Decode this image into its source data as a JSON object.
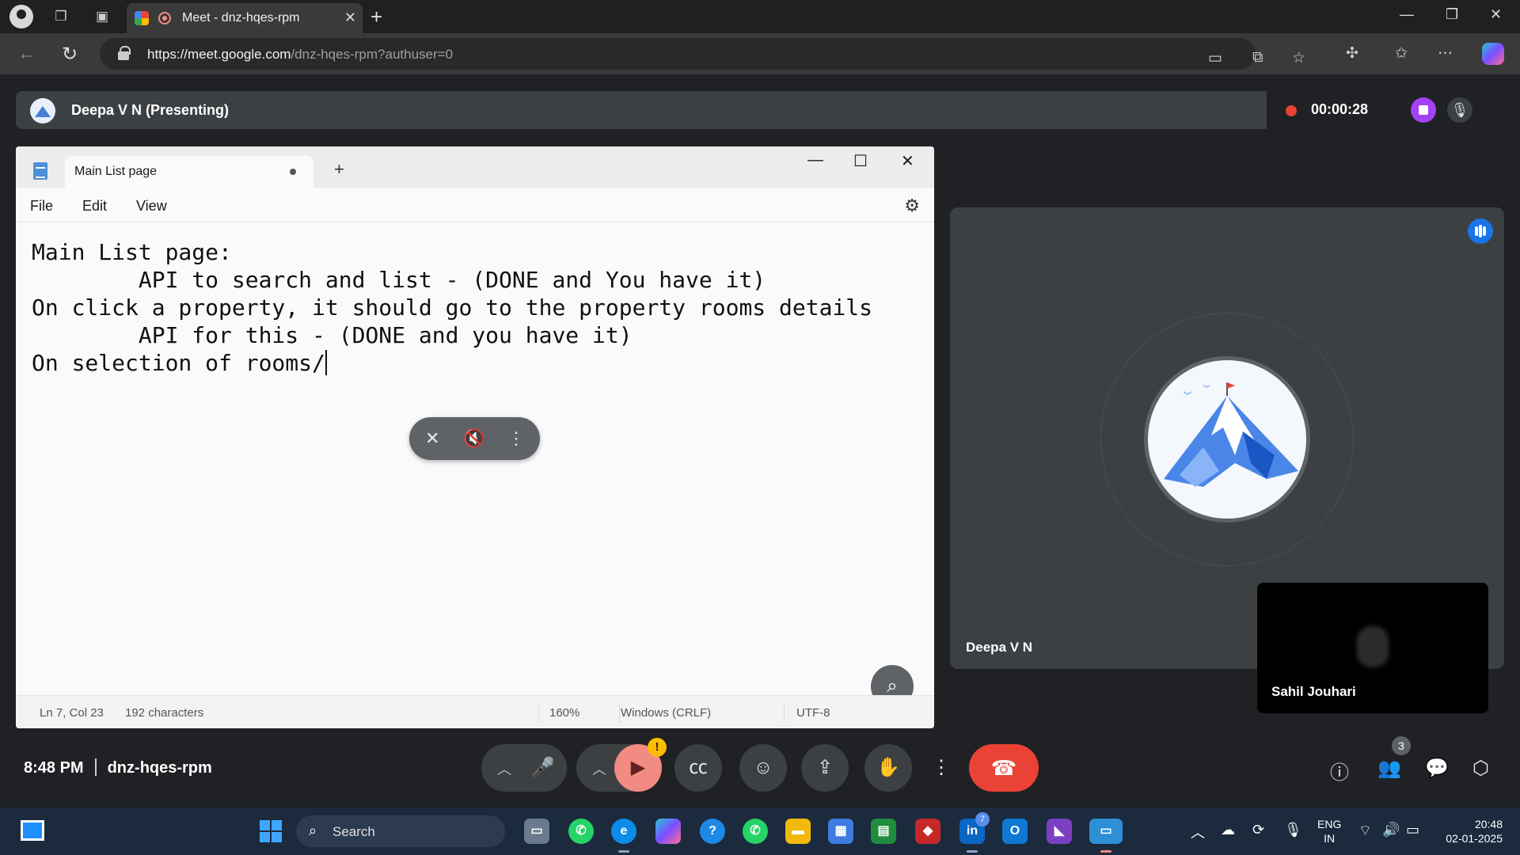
{
  "browser": {
    "tab_title": "Meet - dnz-hqes-rpm",
    "url_host": "https://meet.google.com",
    "url_path": "/dnz-hqes-rpm?authuser=0"
  },
  "presenting_bar": {
    "presenter": "Deepa V N (Presenting)",
    "recording_time": "00:00:28"
  },
  "notepad": {
    "tab_title": "Main List page",
    "menu": [
      "File",
      "Edit",
      "View"
    ],
    "lines": [
      "Main List page:",
      "        API to search and list - (DONE and You have it)",
      "",
      "On click a property, it should go to the property rooms details",
      "        API for this - (DONE and you have it)",
      "",
      "On selection of rooms/"
    ],
    "status": {
      "position": "Ln 7, Col 23",
      "characters": "192 characters",
      "zoom": "160%",
      "line_ending": "Windows (CRLF)",
      "encoding": "UTF-8"
    }
  },
  "participants": {
    "main_tile_name": "Deepa V N",
    "self_tile_name": "Sahil Jouhari"
  },
  "meet_bar": {
    "time": "8:48 PM",
    "meeting_code": "dnz-hqes-rpm",
    "people_count": "3",
    "camera_warning": "!"
  },
  "taskbar": {
    "search_label": "Search",
    "outlook_badge": "7",
    "lang_line1": "ENG",
    "lang_line2": "IN",
    "clock_time": "20:48",
    "clock_date": "02-01-2025"
  },
  "colors": {
    "leave_red": "#ea4335",
    "record_purple": "#a142f4",
    "speaking_blue": "#1a73e8",
    "camera_off_pink": "#f28b82"
  }
}
